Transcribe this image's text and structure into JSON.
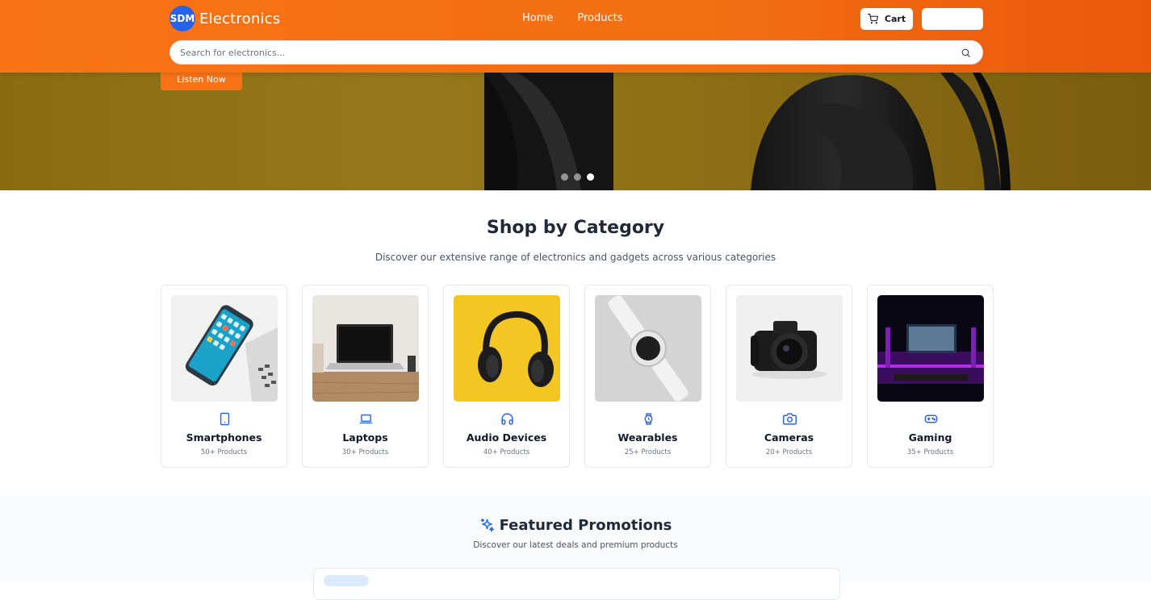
{
  "header": {
    "logo_badge": "SDM",
    "logo_text": "Electronics",
    "nav": [
      {
        "label": "Home"
      },
      {
        "label": "Products"
      }
    ],
    "cart_label": "Cart",
    "account_label": "",
    "search_placeholder": "Search for electronics..."
  },
  "hero": {
    "cta_label": "Listen Now",
    "slides": 3,
    "active_slide": 3
  },
  "categories": {
    "title": "Shop by Category",
    "subtitle": "Discover our extensive range of electronics and gadgets across various categories",
    "items": [
      {
        "name": "Smartphones",
        "count": "50+ Products",
        "icon": "smartphone-icon"
      },
      {
        "name": "Laptops",
        "count": "30+ Products",
        "icon": "laptop-icon"
      },
      {
        "name": "Audio Devices",
        "count": "40+ Products",
        "icon": "headphones-icon"
      },
      {
        "name": "Wearables",
        "count": "25+ Products",
        "icon": "watch-icon"
      },
      {
        "name": "Cameras",
        "count": "20+ Products",
        "icon": "camera-icon"
      },
      {
        "name": "Gaming",
        "count": "35+ Products",
        "icon": "gamepad-icon"
      }
    ]
  },
  "featured": {
    "title": "Featured Promotions",
    "subtitle": "Discover our latest deals and premium products"
  },
  "colors": {
    "brand_orange": "#f97316",
    "logo_blue": "#2563eb",
    "icon_blue": "#2563eb"
  }
}
